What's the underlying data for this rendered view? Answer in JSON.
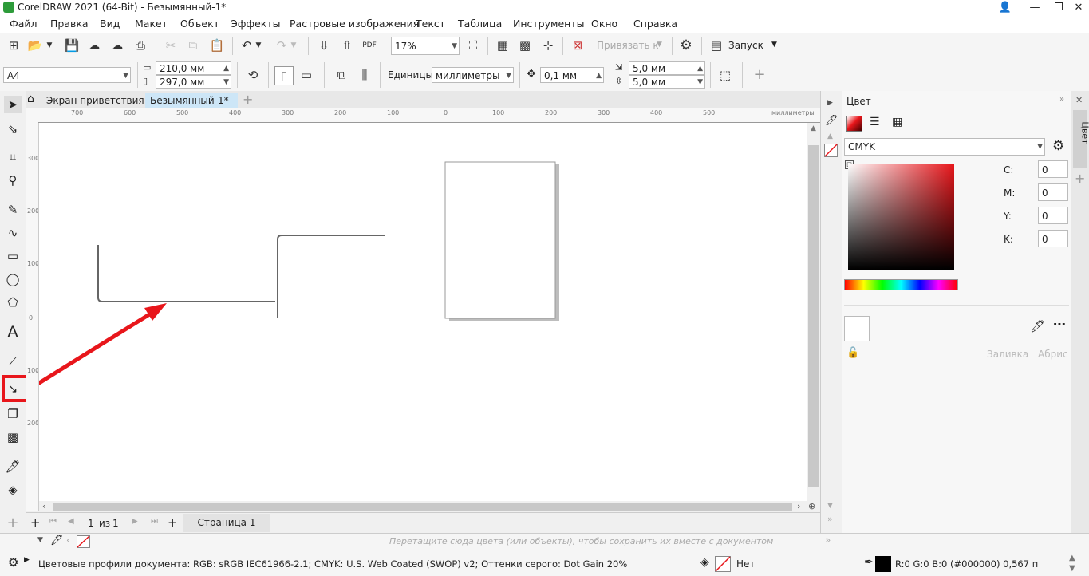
{
  "window": {
    "title": "CorelDRAW 2021 (64-Bit) - Безымянный-1*",
    "buttons": {
      "user": "👤",
      "minimize": "—",
      "restore": "❐",
      "close": "✕"
    }
  },
  "menu": [
    "Файл",
    "Правка",
    "Вид",
    "Макет",
    "Объект",
    "Эффекты",
    "Растровые изображения",
    "Текст",
    "Таблица",
    "Инструменты",
    "Окно",
    "Справка"
  ],
  "toolbar": {
    "zoom": "17%",
    "snap_label": "Привязать к",
    "launch_label": "Запуск"
  },
  "propbar": {
    "page_size": "A4",
    "width": "210,0 мм",
    "height": "297,0 мм",
    "units_label": "Единицы:",
    "units_value": "миллиметры",
    "nudge": "0,1 мм",
    "dup_x": "5,0 мм",
    "dup_y": "5,0 мм"
  },
  "tabs": {
    "welcome": "Экран приветствия",
    "doc": "Безымянный-1*"
  },
  "ruler": {
    "unit_label": "миллиметры",
    "h_ticks": [
      "700",
      "600",
      "500",
      "400",
      "300",
      "200",
      "100",
      "0",
      "100",
      "200",
      "300",
      "400",
      "500"
    ],
    "v_ticks": [
      "300",
      "200",
      "100",
      "0",
      "100",
      "200"
    ]
  },
  "pages": {
    "current": "1",
    "of_label": "из",
    "total": "1",
    "tab": "Страница 1"
  },
  "docker": {
    "title": "Цвет",
    "model": "CMYK",
    "labels": {
      "c": "C:",
      "m": "M:",
      "y": "Y:",
      "k": "K:"
    },
    "values": {
      "c": "0",
      "m": "0",
      "y": "0",
      "k": "0"
    },
    "fill_label": "Заливка",
    "outline_label": "Абрис",
    "side_tab": "Цвет"
  },
  "palette_hint": "Перетащите сюда цвета (или объекты), чтобы сохранить их вместе с документом",
  "status": {
    "profiles": "Цветовые профили документа: RGB: sRGB IEC61966-2.1; CMYK: U.S. Web Coated (SWOP) v2; Оттенки серого: Dot Gain 20%",
    "fill_none": "Нет",
    "outline_info": "R:0 G:0 B:0 (#000000)  0,567 п"
  },
  "colors": {
    "highlight": "#e8161b",
    "accent_tab": "#cde6f7"
  }
}
